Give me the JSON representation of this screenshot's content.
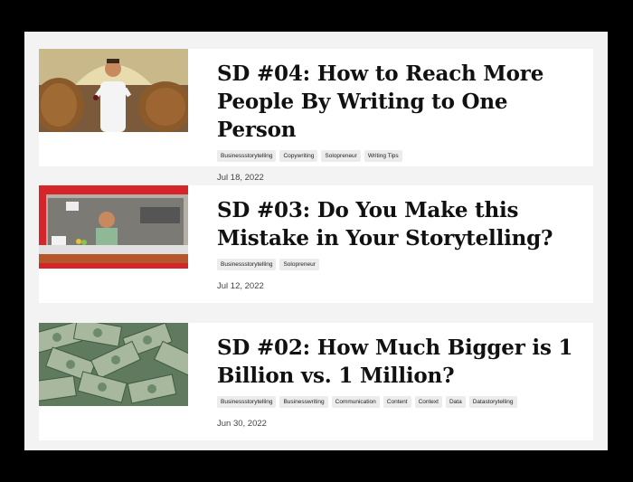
{
  "posts": [
    {
      "title": "SD #04: How to Reach More People By Writing to One Person",
      "tags": [
        "Businessstorytelling",
        "Copywriting",
        "Solopreneur",
        "Writing Tips"
      ],
      "date": "Jul 18, 2022",
      "image": "man-in-wine-cellar"
    },
    {
      "title": "SD #03: Do You Make this Mistake in Your Storytelling?",
      "tags": [
        "Businessstorytelling",
        "Solopreneur"
      ],
      "date": "Jul 12, 2022",
      "image": "man-at-food-truck-window"
    },
    {
      "title": "SD #02: How Much Bigger is 1 Billion vs. 1 Million?",
      "tags": [
        "Businessstorytelling",
        "Businesswriting",
        "Communication",
        "Content",
        "Context",
        "Data",
        "Datastorytelling"
      ],
      "date": "Jun 30, 2022",
      "image": "pile-of-dollar-bills"
    }
  ]
}
